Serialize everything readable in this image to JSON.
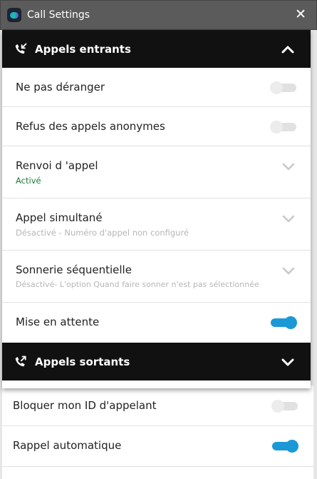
{
  "window": {
    "title": "Call Settings",
    "close_glyph": "✕"
  },
  "incoming": {
    "title": "Appels entrants",
    "icon": "incoming-call-icon",
    "expanded": true,
    "items": [
      {
        "label": "Ne pas déranger",
        "control": "toggle",
        "enabled": false
      },
      {
        "label": "Refus des appels anonymes",
        "control": "toggle",
        "enabled": false
      },
      {
        "label": "Renvoi d 'appel",
        "sub": "Activé",
        "control": "chevron"
      },
      {
        "label": "Appel simultané",
        "sub": "Désactivé - Numéro d'appel non configuré",
        "control": "chevron"
      },
      {
        "label": "Sonnerie séquentielle",
        "sub": "Désactivé- L'option Quand faire sonner n'est pas sélectionnée",
        "control": "chevron"
      },
      {
        "label": "Mise en attente",
        "control": "toggle",
        "enabled": true
      }
    ]
  },
  "outgoing": {
    "title": "Appels sortants",
    "icon": "outgoing-call-icon",
    "expanded": false,
    "items": [
      {
        "label": "Bloquer mon ID d'appelant",
        "control": "toggle",
        "enabled": false
      },
      {
        "label": "Rappel automatique",
        "control": "toggle",
        "enabled": true
      }
    ]
  },
  "colors": {
    "header_bg": "#111111",
    "accent": "#1b98d6",
    "active_text": "#1f7a3a",
    "inactive_text": "#b6b6b6"
  }
}
